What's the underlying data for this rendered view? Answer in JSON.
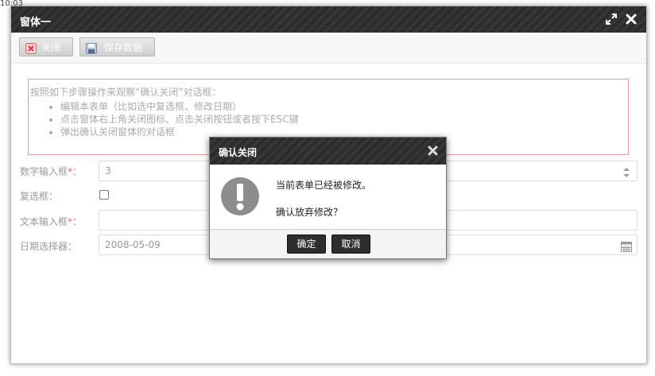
{
  "time_fragment": "10:03",
  "window": {
    "title": "窗体一",
    "icons": [
      "maximize-icon",
      "close-icon"
    ]
  },
  "toolbar": {
    "close_label": "关闭",
    "save_label": "保存数据"
  },
  "tips": {
    "intro": "按照如下步骤操作来观察“确认关闭”对话框：",
    "items": [
      "编辑本表单（比如选中复选框、修改日期）",
      "点击窗体右上角关闭图标、点击关闭按钮或者按下ESC键",
      "弹出确认关闭窗体的对话框"
    ]
  },
  "form": {
    "number_label": "数字输入框",
    "number_value": "3",
    "checkbox_label": "复选框：",
    "text_label": "文本输入框",
    "text_value": "",
    "date_label": "日期选择器：",
    "date_value": "2008-05-09",
    "required_mark": "*",
    "colon": "："
  },
  "dialog": {
    "title": "确认关闭",
    "message_line1": "当前表单已经被修改。",
    "message_line2": "确认放弃修改？",
    "ok_label": "确定",
    "cancel_label": "取消"
  },
  "colors": {
    "header_dark": "#2d2d2d",
    "tip_border": "#e69a9a",
    "required": "#e26a6a",
    "dialog_button": "#2e2e2e"
  }
}
